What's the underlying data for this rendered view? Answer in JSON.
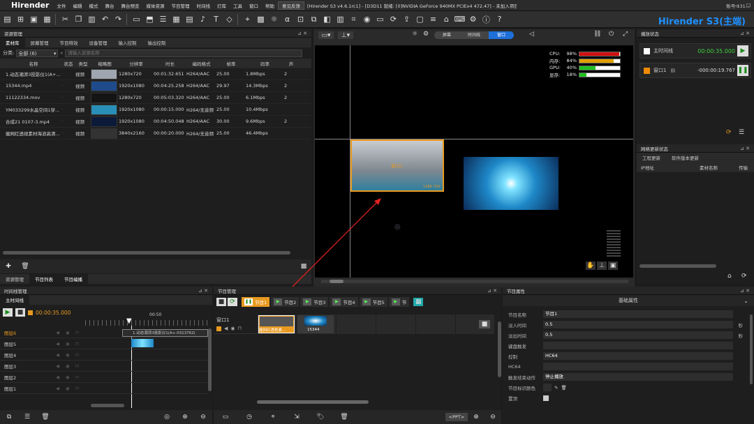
{
  "menubar": {
    "app": "Hirender",
    "items": [
      "文件",
      "编辑",
      "模式",
      "舞台",
      "舞台预览",
      "媒体资源",
      "节目管理",
      "时间线",
      "灯库",
      "工具",
      "窗口",
      "帮助"
    ],
    "highlight": "意见反馈",
    "title": "[Hirender S3 v4.6.1rc1] - [D3D11 就绪: [0]NVIDIA GeForce 940MX PCIEx4 472.47] - 未加入项目 - C:\\Users\\EDZ\\Desktop\\工程\\4.6.0.hs3",
    "account": "账号:131..."
  },
  "brand": "Hirender S3(主端)",
  "asset": {
    "title": "资源管理",
    "tabs": [
      "素材库",
      "屏幕管理",
      "节目特效",
      "设备管理",
      "输入控制",
      "输出控制"
    ],
    "filter_label": "分类:",
    "filter_value": "全部  (6)",
    "search_placeholder": "请输入资源名称",
    "columns": [
      "名称",
      "状态",
      "类型",
      "缩略图",
      "分辨率",
      "时长",
      "编码格式",
      "帧率",
      "码率",
      "声"
    ],
    "rows": [
      {
        "name": "1.动态潮湃3投影仪1(A+...",
        "type": "视频",
        "res": "1280x720",
        "dur": "00:01:32.651",
        "codec": "H264/AAC",
        "fps": "25.00",
        "rate": "1.8Mbps",
        "ch": "2",
        "thumb": "#a0a6b0"
      },
      {
        "name": "15344.mp4",
        "type": "视频",
        "res": "1920x1080",
        "dur": "00:04:25.258",
        "codec": "H264/AAC",
        "fps": "29.97",
        "rate": "14.3Mbps",
        "ch": "2",
        "thumb": "#1f4b8a"
      },
      {
        "name": "11122334.mov",
        "type": "视频",
        "res": "1280x720",
        "dur": "00:05:03.320",
        "codec": "H264/AAC",
        "fps": "25.00",
        "rate": "6.1Mbps",
        "ch": "2",
        "thumb": "#141414"
      },
      {
        "name": "YM033299水晶空间1穿...",
        "type": "视频",
        "res": "1920x1080",
        "dur": "00:00:15.000",
        "codec": "H264/无音频",
        "fps": "25.00",
        "rate": "10.4Mbps",
        "ch": "",
        "thumb": "#2a8fb8"
      },
      {
        "name": "合成21 0107-3.mp4",
        "type": "视频",
        "res": "1920x1080",
        "dur": "00:04:50.048",
        "codec": "H264/AAC",
        "fps": "30.00",
        "rate": "9.6Mbps",
        "ch": "2",
        "thumb": "#0c1a3a"
      },
      {
        "name": "瘤网红透视素材海浪高清...",
        "type": "视频",
        "res": "3840x2160",
        "dur": "00:00:20.000",
        "codec": "H264/无音频",
        "fps": "25.00",
        "rate": "46.4Mbps",
        "ch": "",
        "thumb": "#333333"
      }
    ],
    "bottom_tabs": [
      "资源管理",
      "节目列表",
      "节目编播"
    ]
  },
  "preview": {
    "tabs": [
      "屏幕",
      "时间线",
      "窗口"
    ],
    "active_tab": "窗口",
    "stats": [
      {
        "label": "CPU:",
        "value": "98%",
        "fill": 0.98,
        "color": "#d01010"
      },
      {
        "label": "内存:",
        "value": "84%",
        "fill": 0.84,
        "color": "#e0a000"
      },
      {
        "label": "GPU:",
        "value": "40%",
        "fill": 0.4,
        "color": "#20c020"
      },
      {
        "label": "显存:",
        "value": "18%",
        "fill": 0.18,
        "color": "#20c020"
      }
    ],
    "win_label": "窗口1",
    "win_sub": "1280 720"
  },
  "playstat": {
    "title": "播放状态",
    "items": [
      {
        "name": "主时间线",
        "time": "00:00:35.000",
        "color": "#ffffff"
      },
      {
        "name": "窗口1",
        "time": "-000:00:19.767",
        "color": "#f08a00"
      }
    ]
  },
  "netstat": {
    "title": "网络更新状态",
    "tabs": [
      "工程更新",
      "软件版本更新"
    ],
    "columns": [
      "IP地址",
      "素材名称",
      "传输"
    ]
  },
  "timeline": {
    "title": "时间线管理",
    "tab": "主时间线",
    "time": "00:00:35.000",
    "ruler": "00:50",
    "layers": [
      "图层6",
      "图层5",
      "图层4",
      "图层3",
      "图层2",
      "图层1"
    ],
    "clip": "1.动态潮湃3投影仪1(A+-0313762("
  },
  "program": {
    "title": "节目管理",
    "programs": [
      "节目1",
      "节目2",
      "节目3",
      "节目4",
      "节目5",
      "节"
    ],
    "window": "窗口1",
    "clips": [
      {
        "label": "瘤网红透视素...",
        "color": "#e89a20"
      },
      {
        "label": "15344",
        "color": "#3a3a3a"
      }
    ],
    "ppt": "<PPT>"
  },
  "props": {
    "title": "节目属性",
    "section": "基础属性",
    "fields": [
      {
        "label": "节目名称",
        "value": "节目1",
        "unit": ""
      },
      {
        "label": "淡入时间",
        "value": "0.5",
        "unit": "秒"
      },
      {
        "label": "淡出时间",
        "value": "0.5",
        "unit": "秒"
      },
      {
        "label": "键盘触发",
        "value": "",
        "unit": ""
      },
      {
        "label": "控制",
        "value": "HC64",
        "unit": ""
      },
      {
        "label": "HC64",
        "value": "",
        "unit": ""
      },
      {
        "label": "触发结束动作",
        "value": "停止播放",
        "unit": ""
      },
      {
        "label": "节目标识颜色",
        "value": "",
        "unit": ""
      },
      {
        "label": "置顶",
        "value": "",
        "unit": ""
      }
    ]
  }
}
